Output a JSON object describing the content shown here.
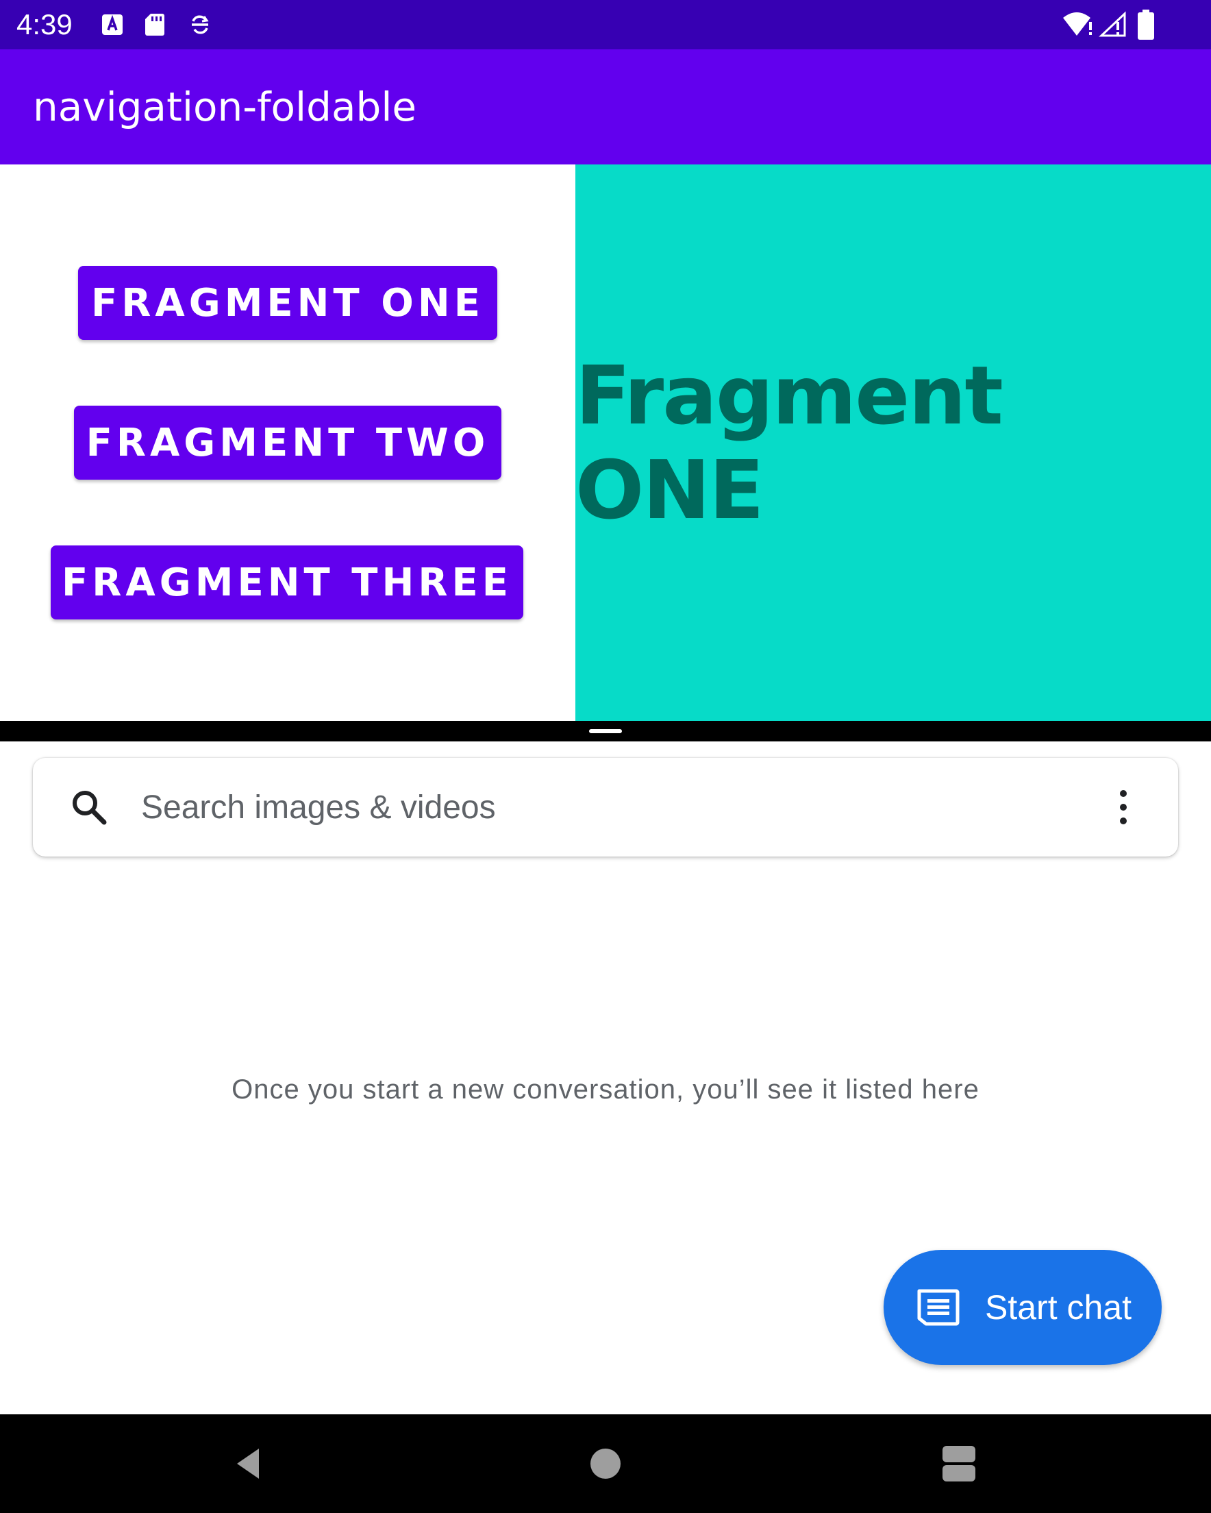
{
  "status_bar": {
    "time": "4:39",
    "icons": [
      "a-notification-icon",
      "sd-card-icon",
      "sync-icon",
      "wifi-icon",
      "signal-icon",
      "battery-icon"
    ]
  },
  "app_bar": {
    "title": "navigation-foldable"
  },
  "left_pane": {
    "buttons": [
      {
        "label": "FRAGMENT ONE"
      },
      {
        "label": "FRAGMENT TWO"
      },
      {
        "label": "FRAGMENT THREE"
      }
    ]
  },
  "right_pane": {
    "text": "Fragment ONE"
  },
  "messages_app": {
    "search": {
      "placeholder": "Search images & videos"
    },
    "empty_state": "Once you start a new conversation, you’ll see it listed here",
    "fab": {
      "label": "Start chat"
    }
  },
  "colors": {
    "status_bar": "#3700b3",
    "primary": "#6200ee",
    "fragment_bg": "#07dbc8",
    "fragment_text": "#00695c",
    "fab": "#1a73e8"
  },
  "nav_bar": {
    "buttons": [
      "back-icon",
      "home-icon",
      "recents-icon"
    ]
  }
}
